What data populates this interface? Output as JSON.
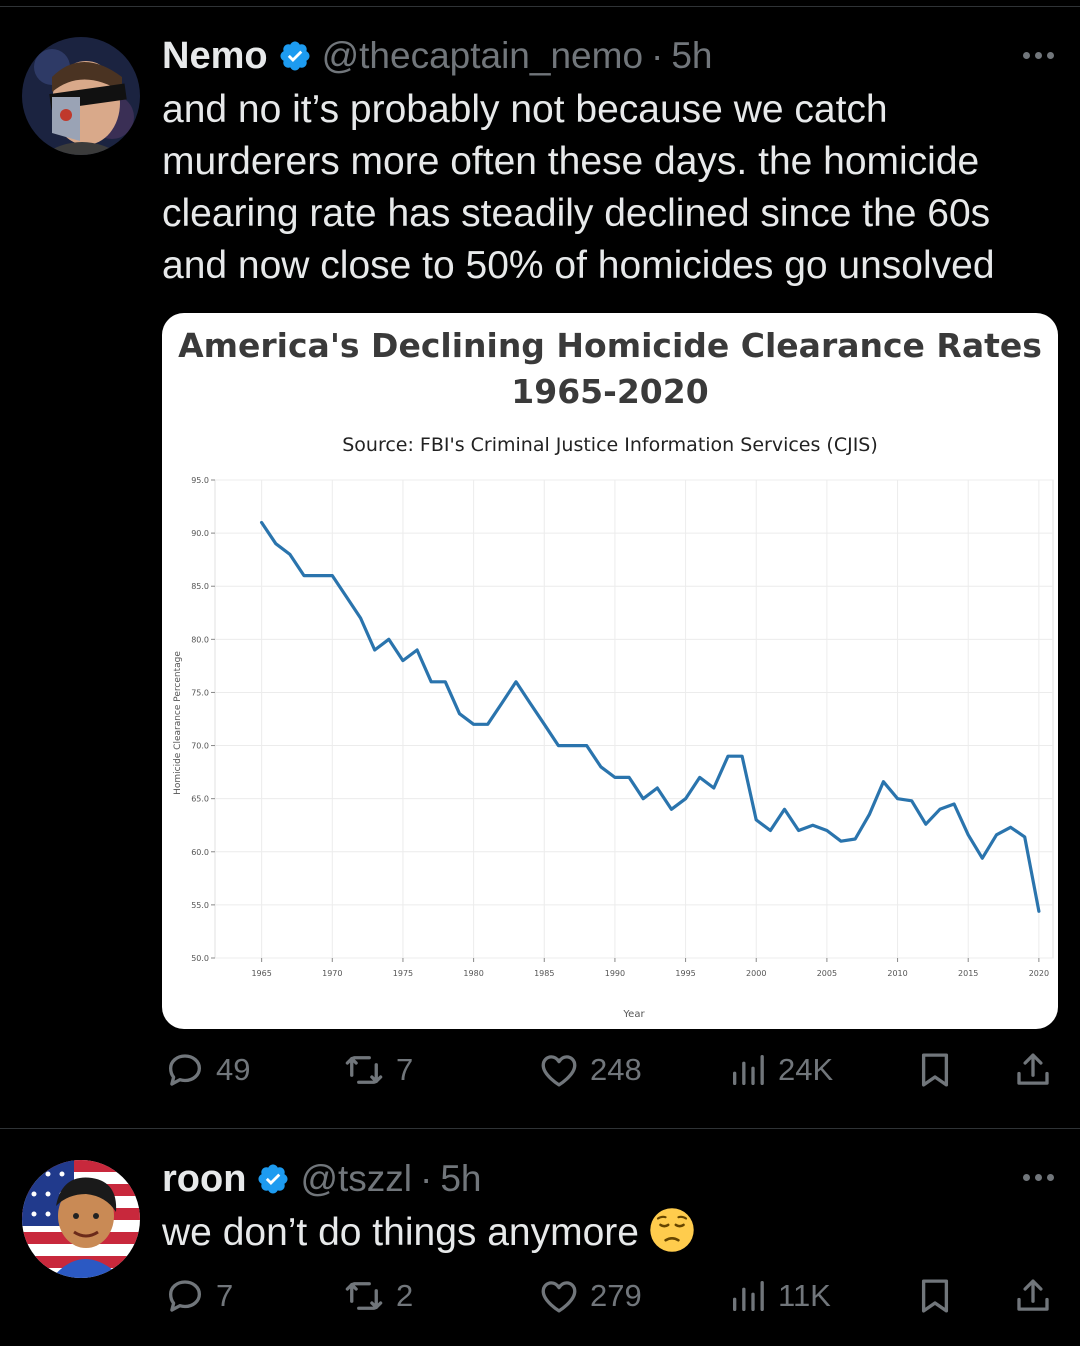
{
  "tweets": [
    {
      "name": "Nemo",
      "handle": "@thecaptain_nemo",
      "time": "5h",
      "text_lines": [
        "and no it’s probably not because we catch",
        "murderers more often these days. the homicide",
        "clearing rate has steadily declined since the 60s",
        "and now close to 50% of homicides go unsolved"
      ],
      "replies": "49",
      "reposts": "7",
      "likes": "248",
      "views": "24K"
    },
    {
      "name": "roon",
      "handle": "@tszzl",
      "time": "5h",
      "text": "we don’t do things anymore",
      "emoji": "pensive-face",
      "replies": "7",
      "reposts": "2",
      "likes": "279",
      "views": "11K"
    }
  ],
  "chart_data": {
    "type": "line",
    "title": "America's Declining Homicide Clearance Rates",
    "subtitle": "1965-2020",
    "source": "Source: FBI's Criminal Justice Information Services (CJIS)",
    "xlabel": "Year",
    "ylabel": "Homicide Clearance Percentage",
    "xlim": [
      1961.7,
      2021
    ],
    "ylim": [
      50,
      95
    ],
    "x_ticks": [
      "1965",
      "1970",
      "1975",
      "1980",
      "1985",
      "1990",
      "1995",
      "2000",
      "2005",
      "2010",
      "2015",
      "2020"
    ],
    "y_ticks": [
      "50.0",
      "55.0",
      "60.0",
      "65.0",
      "70.0",
      "75.0",
      "80.0",
      "85.0",
      "90.0",
      "95.0"
    ],
    "grid": true,
    "line_color": "#2a74ad",
    "series": [
      {
        "x": [
          1965,
          1966,
          1967,
          1968,
          1969,
          1970,
          1971,
          1972,
          1973,
          1974,
          1975,
          1976,
          1977,
          1978,
          1979,
          1980,
          1981,
          1982,
          1983,
          1984,
          1985,
          1986,
          1987,
          1988,
          1989,
          1990,
          1991,
          1992,
          1993,
          1994,
          1995,
          1996,
          1997,
          1998,
          1999,
          2000,
          2001,
          2002,
          2003,
          2004,
          2005,
          2006,
          2007,
          2008,
          2009,
          2010,
          2011,
          2012,
          2013,
          2014,
          2015,
          2016,
          2017,
          2018,
          2019,
          2020
        ],
        "y": [
          91,
          89,
          88,
          86,
          86,
          86,
          84,
          82,
          79,
          80,
          78,
          79,
          76,
          76,
          73,
          72,
          72,
          74,
          76,
          74,
          72,
          70,
          70,
          70,
          68,
          67,
          67,
          65,
          66,
          64,
          65,
          67,
          66,
          69,
          69,
          63,
          62,
          64,
          62,
          62.5,
          62,
          61,
          61.2,
          63.5,
          66.6,
          65,
          64.8,
          62.6,
          64,
          64.5,
          61.6,
          59.4,
          61.6,
          62.3,
          61.4,
          54.4
        ]
      }
    ]
  },
  "colors": {
    "background": "#000000",
    "text": "#e7e9ea",
    "secondary": "#71767b",
    "verified": "#1d9bf0"
  }
}
